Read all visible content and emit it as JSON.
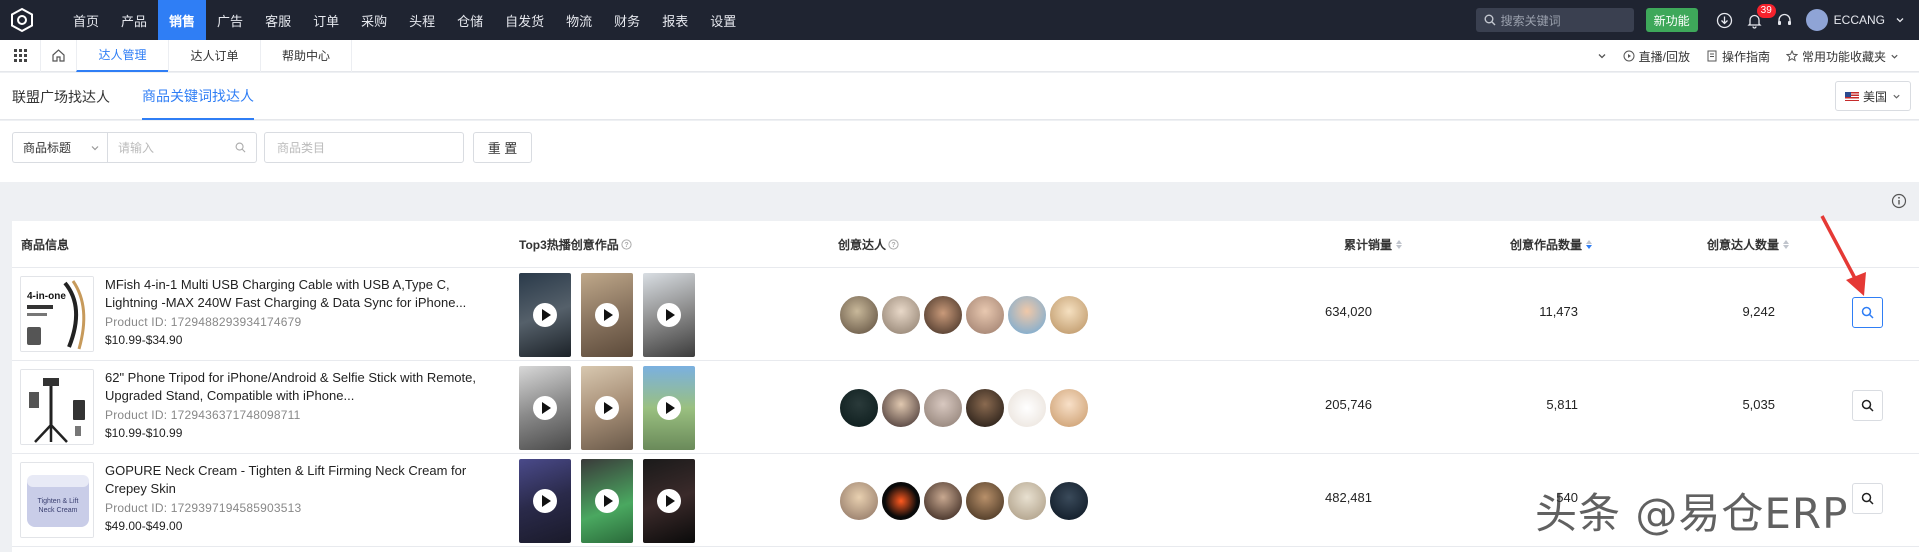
{
  "topnav": {
    "menu": [
      "首页",
      "产品",
      "销售",
      "广告",
      "客服",
      "订单",
      "采购",
      "头程",
      "仓储",
      "自发货",
      "物流",
      "财务",
      "报表",
      "设置"
    ],
    "active_menu": "销售",
    "search_placeholder": "搜索关键词",
    "new_feature_label": "新功能",
    "notification_count": "39",
    "username": "ECCANG"
  },
  "subnav": {
    "tabs": [
      "达人管理",
      "达人订单",
      "帮助中心"
    ],
    "live_label": "直播/回放",
    "guide_label": "操作指南",
    "favorites_label": "常用功能收藏夹"
  },
  "page_tabs": [
    "联盟广场找达人",
    "商品关键词找达人"
  ],
  "country": "美国",
  "filters": {
    "field_select": "商品标题",
    "keyword_placeholder": "请输入",
    "category_placeholder": "商品类目",
    "reset_label": "重 置"
  },
  "table": {
    "headers": {
      "product": "商品信息",
      "top3": "Top3热播创意作品",
      "creators": "创意达人",
      "sales": "累计销量",
      "works": "创意作品数量",
      "creator_count": "创意达人数量"
    },
    "rows": [
      {
        "name": "MFish 4-in-1 Multi USB Charging Cable with USB A,Type C, Lightning -MAX 240W Fast Charging & Data Sync for iPhone...",
        "product_id": "Product ID:  1729488293934174679",
        "price": "$10.99-$34.90",
        "thumb_text": "4-in-one",
        "sales": "634,020",
        "works": "11,473",
        "creators": "9,242"
      },
      {
        "name": "62\" Phone Tripod for iPhone/Android & Selfie Stick with Remote, Upgraded Stand, Compatible with iPhone...",
        "product_id": "Product ID:  1729436371748098711",
        "price": "$10.99-$10.99",
        "thumb_text": "",
        "sales": "205,746",
        "works": "5,811",
        "creators": "5,035"
      },
      {
        "name": "GOPURE Neck Cream - Tighten & Lift Firming Neck Cream for Crepey Skin",
        "product_id": "Product ID:  1729397194585903513",
        "price": "$49.00-$49.00",
        "thumb_text": "Tighten & Lift Neck Cream",
        "sales": "482,481",
        "works": "540",
        "creators": ""
      }
    ]
  },
  "watermark": "头条 @易仓ERP",
  "colors": {
    "topnav_bg": "#1f2431",
    "accent": "#2f7ef5",
    "new_feature": "#3ea85a",
    "badge": "#f5222d",
    "annotation_arrow": "#e53935"
  }
}
